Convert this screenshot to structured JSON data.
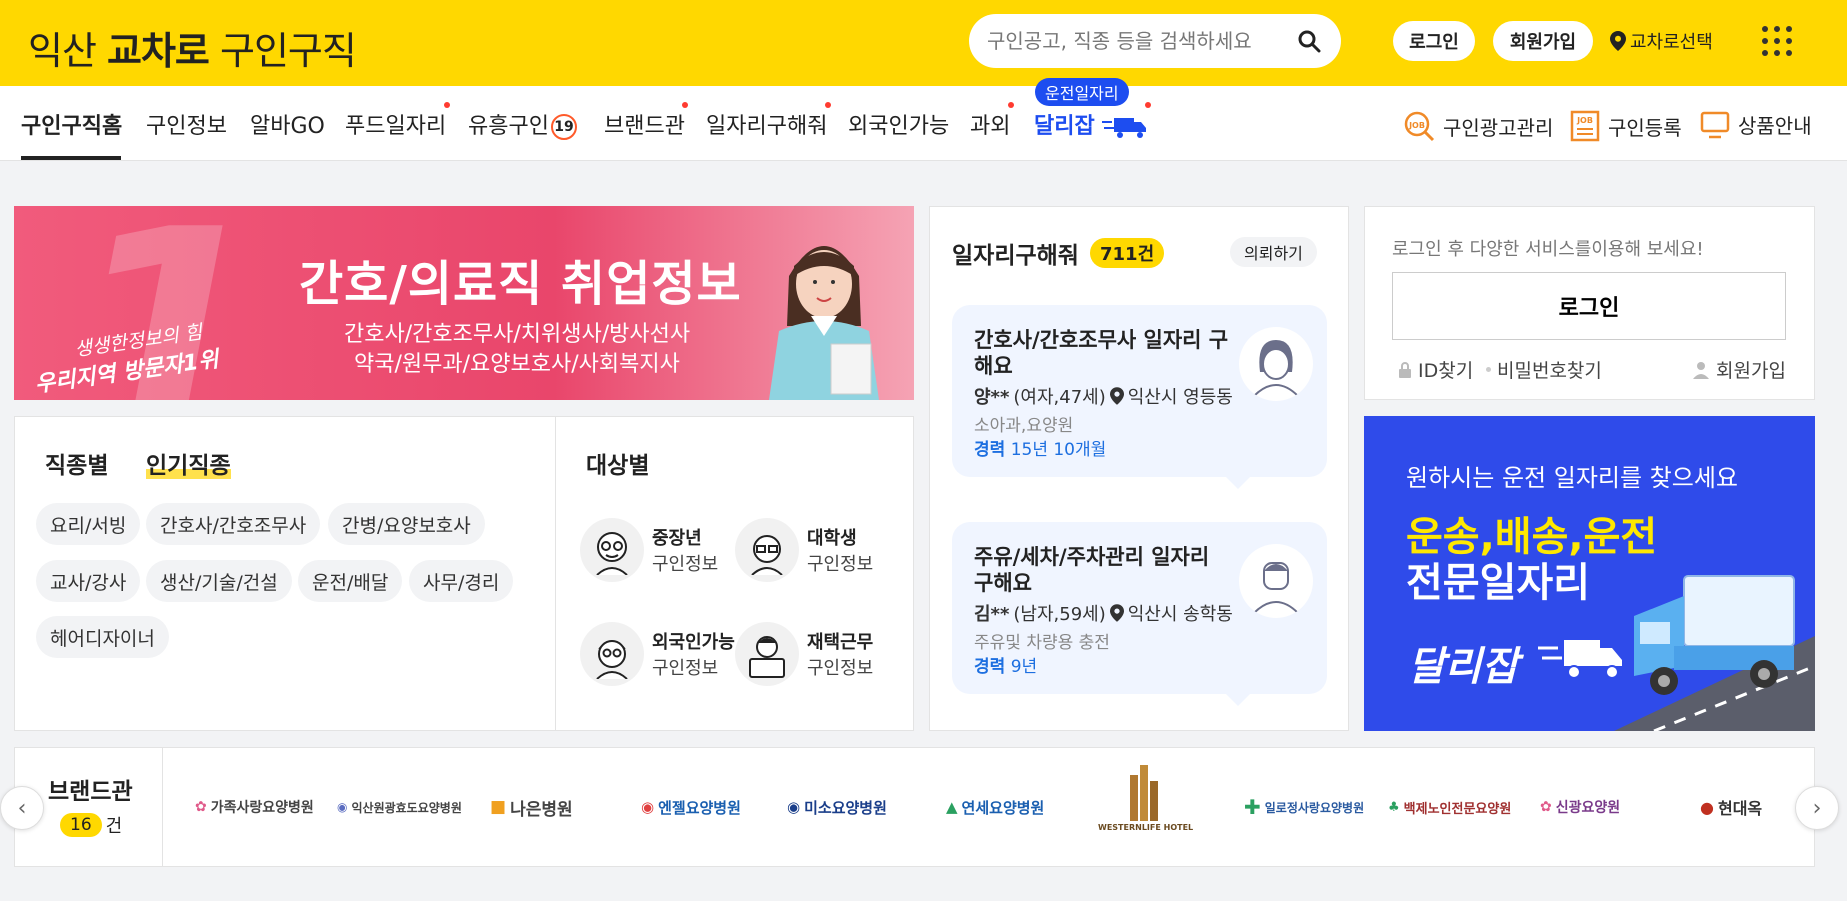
{
  "header": {
    "logo_region": "익산",
    "logo_brand": "교차로",
    "logo_service": "구인구직",
    "search_placeholder": "구인공고, 직종 등을 검색하세요",
    "login_label": "로그인",
    "signup_label": "회원가입",
    "region_label": "교차로선택",
    "brand_color": "#ffd800"
  },
  "nav": {
    "items": [
      "구인구직홈",
      "구인정보",
      "알바GO",
      "푸드일자리",
      "유흥구인",
      "브랜드관",
      "일자리구해줘",
      "외국인가능",
      "과외",
      "달리잡"
    ],
    "adult_badge": "19",
    "bubble": "운전일자리",
    "util": [
      "구인광고관리",
      "구인등록",
      "상품안내"
    ]
  },
  "banner_left": {
    "title": "간호/의료직 취업정보",
    "line1": "간호사/간호조무사/치위생사/방사선사",
    "line2": "약국/원무과/요양보호사/사회복지사",
    "tag1": "생생한정보의 힘",
    "tag2": "우리지역 방문자1위"
  },
  "job_types": {
    "tab1": "직종별",
    "tab2": "인기직종",
    "chips": [
      "요리/서빙",
      "간호사/간호조무사",
      "간병/요양보호사",
      "교사/강사",
      "생산/기술/건설",
      "운전/배달",
      "사무/경리",
      "헤어디자이너"
    ]
  },
  "targets": {
    "title": "대상별",
    "items": [
      {
        "name": "중장년",
        "sub": "구인정보"
      },
      {
        "name": "대학생",
        "sub": "구인정보"
      },
      {
        "name": "외국인가능",
        "sub": "구인정보"
      },
      {
        "name": "재택근무",
        "sub": "구인정보"
      }
    ]
  },
  "jobs_wanted": {
    "title": "일자리구해줘",
    "count": "711건",
    "request": "의뢰하기",
    "cards": [
      {
        "title": "간호사/간호조무사 일자리 구해요",
        "name": "양**",
        "info": "(여자,47세)",
        "location": "익산시 영등동",
        "field": "소아과,요양원",
        "exp_label": "경력",
        "exp": "15년 10개월"
      },
      {
        "title": "주유/세차/주차관리 일자리 구해요",
        "name": "김**",
        "info": "(남자,59세)",
        "location": "익산시 송학동",
        "field": "주유및 차량용 충전",
        "exp_label": "경력",
        "exp": "9년"
      }
    ]
  },
  "login_panel": {
    "message": "로그인 후 다양한 서비스를이용해 보세요!",
    "button": "로그인",
    "find_id": "ID찾기",
    "find_pw": "비밀번호찾기",
    "signup": "회원가입"
  },
  "banner_right": {
    "line1": "원하시는 운전 일자리를 찾으세요",
    "line2": "운송,배송,운전",
    "line3": "전문일자리",
    "brand": "달리잡"
  },
  "brand_zone": {
    "title": "브랜드관",
    "count": "16",
    "unit": "건",
    "logos": [
      "가족사랑요양병원",
      "익산원광효도요양병원",
      "나은병원",
      "엔젤요양병원",
      "미소요양병원",
      "연세요양병원",
      "WESTERNLIFE HOTEL",
      "일로정사랑요양병원",
      "백제노인전문요양원",
      "신광요양원",
      "현대옥"
    ]
  }
}
